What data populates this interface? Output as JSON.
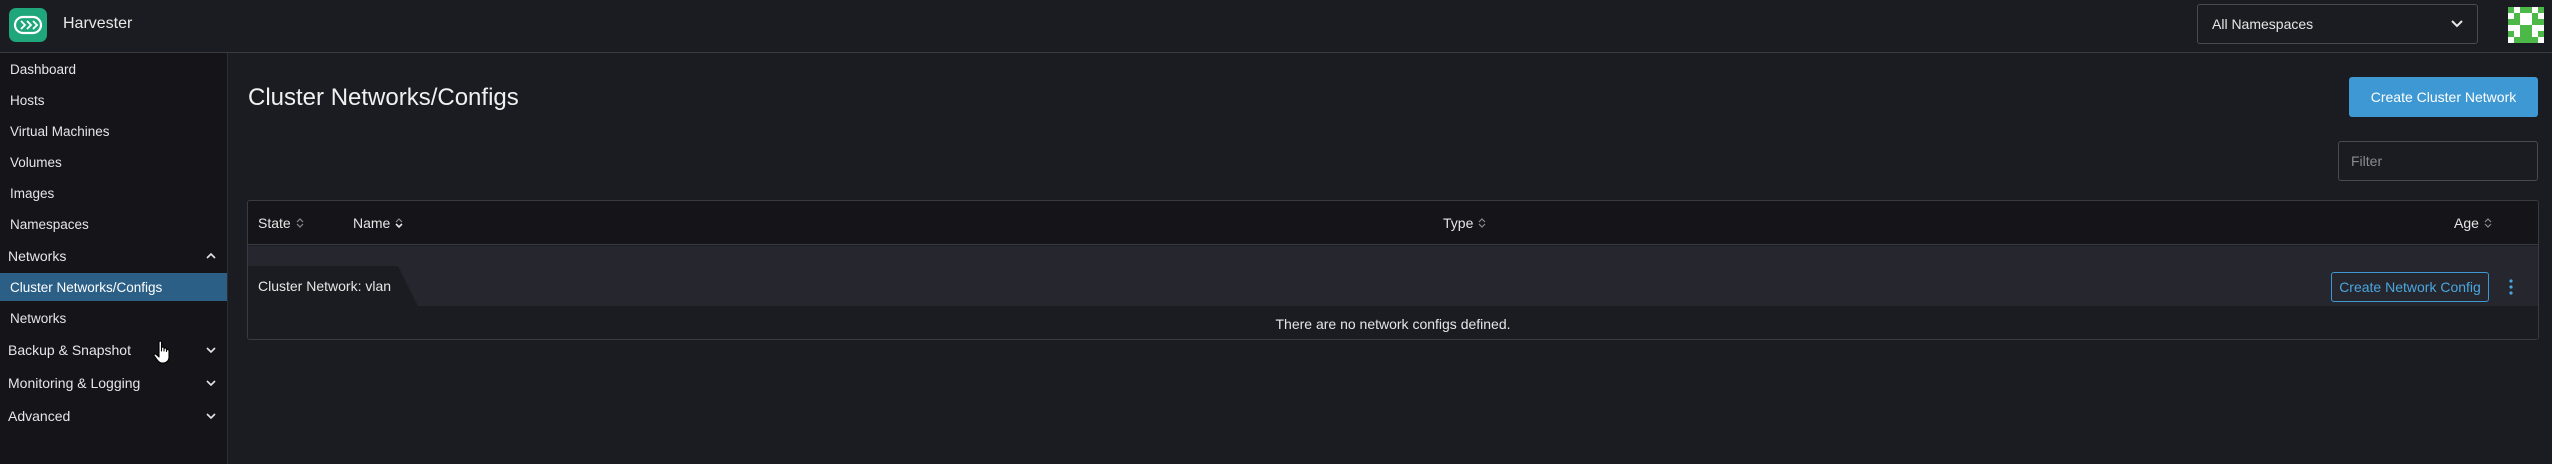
{
  "app": {
    "title": "Harvester",
    "logo_icon": "harvester-logo-icon",
    "brand_color": "#1fa67a",
    "accent_color": "#3d98d3"
  },
  "header": {
    "namespace_selected": "All Namespaces"
  },
  "sidebar": {
    "items": [
      {
        "label": "Dashboard"
      },
      {
        "label": "Hosts"
      },
      {
        "label": "Virtual Machines"
      },
      {
        "label": "Volumes"
      },
      {
        "label": "Images"
      },
      {
        "label": "Namespaces"
      }
    ],
    "networks_group": {
      "label": "Networks",
      "children": [
        {
          "label": "Cluster Networks/Configs",
          "active": true
        },
        {
          "label": "Networks"
        }
      ]
    },
    "groups": [
      {
        "label": "Backup & Snapshot"
      },
      {
        "label": "Monitoring & Logging"
      },
      {
        "label": "Advanced"
      }
    ]
  },
  "main": {
    "title": "Cluster Networks/Configs",
    "create_button": "Create Cluster Network",
    "filter_placeholder": "Filter",
    "table": {
      "columns": [
        "State",
        "Name",
        "Type",
        "Age"
      ],
      "group_label": "Cluster Network: vlan",
      "group_action": "Create Network Config",
      "empty_text": "There are no network configs defined."
    }
  }
}
